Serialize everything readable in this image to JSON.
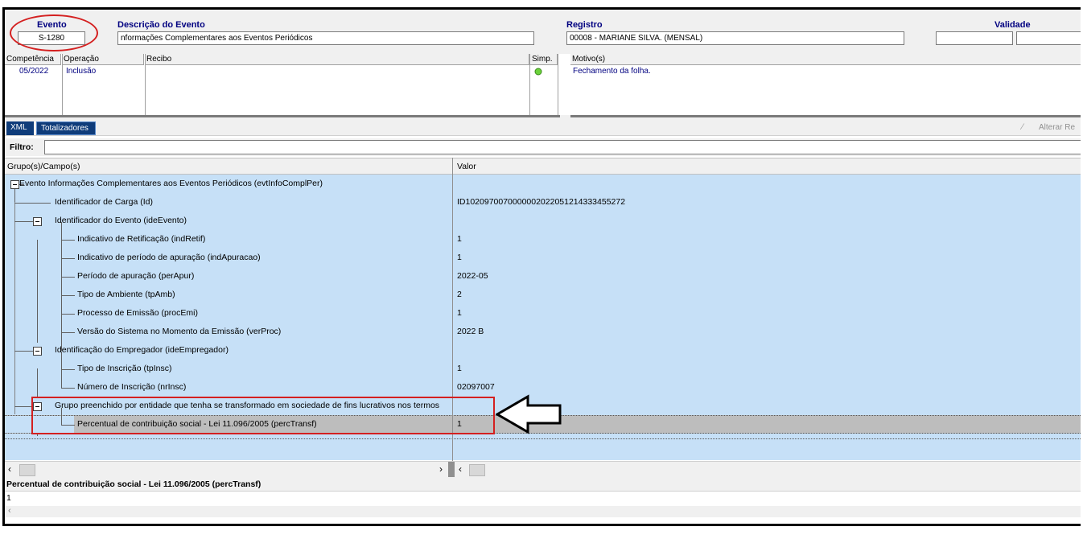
{
  "header": {
    "evento_label": "Evento",
    "evento_value": "S-1280",
    "descricao_label": "Descrição do Evento",
    "descricao_value": "nformações Complementares aos Eventos Periódicos",
    "registro_label": "Registro",
    "registro_value": "00008 - MARIANE SILVA. (MENSAL)",
    "validade_label": "Validade"
  },
  "grid": {
    "columns": [
      "Competência",
      "Operação",
      "Recibo",
      "Simp.",
      "Motivo(s)"
    ],
    "row": {
      "competencia": "05/2022",
      "operacao": "Inclusão",
      "recibo": "",
      "motivo": "Fechamento da folha."
    }
  },
  "tabs": [
    {
      "label": "XML"
    },
    {
      "label": "Totalizadores"
    }
  ],
  "alterar_label": "Alterar Re",
  "filtro_label": "Filtro:",
  "tree_headers": {
    "campo": "Grupo(s)/Campo(s)",
    "valor": "Valor"
  },
  "tree": [
    {
      "label": "Evento Informações Complementares aos Eventos Periódicos (evtInfoComplPer)",
      "value": ""
    },
    {
      "label": "Identificador de Carga (Id)",
      "value": "ID1020970070000002022051214333455272"
    },
    {
      "label": "Identificador do Evento (ideEvento)",
      "value": ""
    },
    {
      "label": "Indicativo de Retificação (indRetif)",
      "value": "1"
    },
    {
      "label": "Indicativo de período de apuração (indApuracao)",
      "value": "1"
    },
    {
      "label": "Período de apuração (perApur)",
      "value": "2022-05"
    },
    {
      "label": "Tipo de Ambiente (tpAmb)",
      "value": "2"
    },
    {
      "label": "Processo de Emissão (procEmi)",
      "value": "1"
    },
    {
      "label": "Versão do Sistema no Momento da Emissão (verProc)",
      "value": "2022 B"
    },
    {
      "label": "Identificação do Empregador (ideEmpregador)",
      "value": ""
    },
    {
      "label": "Tipo de Inscrição (tpInsc)",
      "value": "1"
    },
    {
      "label": "Número de Inscrição (nrInsc)",
      "value": "02097007"
    },
    {
      "label": "Grupo preenchido por entidade que tenha se transformado em sociedade de fins lucrativos nos termos",
      "value": ""
    },
    {
      "label": "Percentual de contribuição social - Lei 11.096/2005 (percTransf)",
      "value": "1"
    }
  ],
  "detail": {
    "title": "Percentual de contribuição social - Lei 11.096/2005 (percTransf)",
    "value": "1"
  },
  "colors": {
    "accent": "#0f3c7a",
    "tree_bg": "#c6e0f7",
    "highlight": "#d42020",
    "selected_row": "#bdbdbd"
  }
}
